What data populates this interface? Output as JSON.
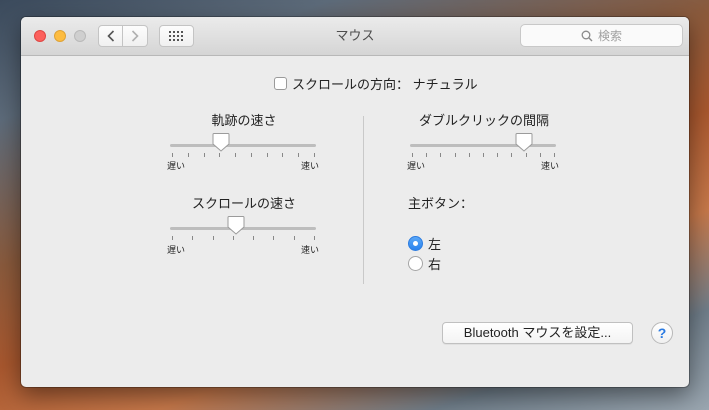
{
  "window": {
    "title": "マウス"
  },
  "toolbar": {
    "back_icon": "chevron-left-icon",
    "forward_icon": "chevron-right-icon",
    "grid_icon": "grid-icon",
    "search_placeholder": "検索",
    "search_icon": "search-icon"
  },
  "scroll_direction": {
    "label": "スクロールの方向： ナチュラル",
    "checked": false
  },
  "tracking_speed": {
    "title": "軌跡の速さ",
    "min_label": "遅い",
    "max_label": "速い",
    "value_fraction": 0.35,
    "ticks": 10
  },
  "scroll_speed": {
    "title": "スクロールの速さ",
    "min_label": "遅い",
    "max_label": "速い",
    "value_fraction": 0.45,
    "ticks": 8
  },
  "double_click": {
    "title": "ダブルクリックの間隔",
    "min_label": "遅い",
    "max_label": "速い",
    "value_fraction": 0.78,
    "ticks": 11
  },
  "primary_button": {
    "title": "主ボタン：",
    "options": [
      {
        "label": "左",
        "selected": true
      },
      {
        "label": "右",
        "selected": false
      }
    ]
  },
  "bluetooth_button": {
    "label": "Bluetooth マウスを設定..."
  },
  "help_button": {
    "label": "?"
  },
  "colors": {
    "accent": "#2a83ee",
    "close": "#fc605c",
    "minimize": "#fdbc40"
  }
}
